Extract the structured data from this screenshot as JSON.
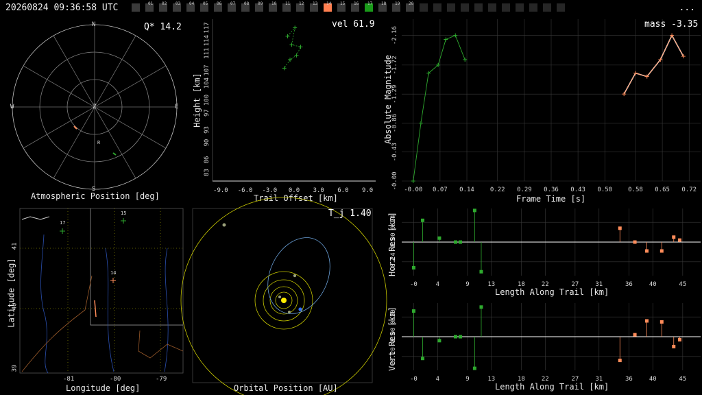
{
  "header": {
    "timestamp": "20260824 09:36:58 UTC",
    "menu_label": "...",
    "frames": [
      {
        "label": "",
        "state": "off"
      },
      {
        "label": "01",
        "state": "off"
      },
      {
        "label": "02",
        "state": "off"
      },
      {
        "label": "03",
        "state": "off"
      },
      {
        "label": "04",
        "state": "off"
      },
      {
        "label": "05",
        "state": "off"
      },
      {
        "label": "06",
        "state": "off"
      },
      {
        "label": "07",
        "state": "off"
      },
      {
        "label": "08",
        "state": "off"
      },
      {
        "label": "09",
        "state": "off"
      },
      {
        "label": "10",
        "state": "off"
      },
      {
        "label": "11",
        "state": "off"
      },
      {
        "label": "12",
        "state": "off"
      },
      {
        "label": "13",
        "state": "off"
      },
      {
        "label": "14",
        "state": "selected"
      },
      {
        "label": "15",
        "state": "off"
      },
      {
        "label": "16",
        "state": "off"
      },
      {
        "label": "17",
        "state": "active"
      },
      {
        "label": "18",
        "state": "off"
      },
      {
        "label": "19",
        "state": "off"
      },
      {
        "label": "20",
        "state": "off"
      },
      {
        "label": "",
        "state": "empty"
      },
      {
        "label": "",
        "state": "empty"
      },
      {
        "label": "",
        "state": "empty"
      },
      {
        "label": "",
        "state": "empty"
      },
      {
        "label": "",
        "state": "empty"
      },
      {
        "label": "",
        "state": "empty"
      },
      {
        "label": "",
        "state": "empty"
      },
      {
        "label": "",
        "state": "empty"
      },
      {
        "label": "",
        "state": "empty"
      },
      {
        "label": "",
        "state": "empty"
      },
      {
        "label": "",
        "state": "empty"
      }
    ]
  },
  "colors": {
    "selected": "#ff7f50",
    "active": "#1a9a1a",
    "inactive": "#3a3a3a",
    "trace": "#2eaa2e",
    "fit": "#ff8c5a",
    "grid": "#3a3a3a"
  },
  "sky": {
    "title": "Atmospheric Position [deg]",
    "q_label": "Q* 14.2",
    "cardinals": {
      "n": "N",
      "s": "S",
      "e": "E",
      "w": "W",
      "z": "Z"
    },
    "station_mark": "R"
  },
  "height_panel": {
    "readout": "vel 61.9",
    "xlabel": "Trail Offset [km]",
    "ylabel": "Height [km]",
    "xticks": [
      "-9.0",
      "-6.0",
      "-3.0",
      "0.0",
      "3.0",
      "6.0",
      "9.0"
    ],
    "yticks": [
      "117",
      "114",
      "111",
      "107",
      "104",
      "100",
      "97",
      "93",
      "90",
      "86",
      "83"
    ]
  },
  "mag_panel": {
    "readout": "mass -3.35",
    "xlabel": "Frame Time [s]",
    "ylabel": "Absolute Magnitude",
    "xticks": [
      "-0.00",
      "0.07",
      "0.14",
      "0.22",
      "0.29",
      "0.36",
      "0.43",
      "0.50",
      "0.58",
      "0.65",
      "0.72"
    ],
    "yticks": [
      "-2.16",
      "-1.72",
      "-1.29",
      "-0.86",
      "-0.43",
      "-0.00"
    ]
  },
  "map_panel": {
    "xlabel": "Longitude [deg]",
    "ylabel": "Latitude [deg]",
    "xticks": [
      "-81",
      "-80",
      "-79"
    ],
    "yticks": [
      "41",
      "40",
      "39"
    ],
    "markers": [
      "17",
      "15",
      "14"
    ]
  },
  "orbit_panel": {
    "readout": "T_j 1.40",
    "xlabel": "Orbital Position [AU]"
  },
  "horz_panel": {
    "xlabel": "Length Along Trail [km]",
    "ylabel": "Horz Res [km]",
    "xticks": [
      "-0",
      "4",
      "9",
      "13",
      "18",
      "22",
      "27",
      "31",
      "36",
      "40",
      "45"
    ],
    "yticks": [
      "0.24",
      "-0.00",
      "-0.24"
    ]
  },
  "vert_panel": {
    "xlabel": "Length Along Trail [km]",
    "ylabel": "Vert Res [km]",
    "xticks": [
      "-0",
      "4",
      "9",
      "13",
      "18",
      "22",
      "27",
      "31",
      "36",
      "40",
      "45"
    ],
    "yticks": [
      "0.20",
      "-0.00",
      "-0.20"
    ]
  },
  "chart_data": [
    {
      "type": "scatter",
      "name": "height-vs-offset",
      "xlabel": "Trail Offset [km]",
      "ylabel": "Height [km]",
      "xlim": [
        -10,
        10
      ],
      "ylim": [
        81,
        119
      ],
      "series": [
        {
          "x": [
            -0.8,
            0.1,
            -0.3,
            0.8,
            0.3,
            -0.5,
            -1.2
          ],
          "y": [
            115,
            117,
            113,
            112.5,
            110.5,
            109.5,
            107.5
          ]
        }
      ]
    },
    {
      "type": "line",
      "name": "magnitude-vs-time",
      "xlabel": "Frame Time [s]",
      "ylabel": "Absolute Magnitude",
      "xlim": [
        -0.03,
        0.75
      ],
      "ylim": [
        0.0,
        -2.4
      ],
      "series": [
        {
          "x": [
            0.0,
            0.02,
            0.04,
            0.065,
            0.085,
            0.11,
            0.135
          ],
          "y": [
            0.0,
            -0.86,
            -1.6,
            -1.72,
            -2.1,
            -2.16,
            -1.8
          ],
          "color": "#2eaa2e"
        },
        {
          "x": [
            0.55,
            0.58,
            0.61,
            0.645,
            0.675,
            0.705
          ],
          "y": [
            -1.29,
            -1.6,
            -1.55,
            -1.8,
            -2.16,
            -1.85
          ],
          "color": "#ff8c5a"
        }
      ]
    },
    {
      "type": "scatter",
      "name": "horizontal-residuals",
      "xlabel": "Length Along Trail [km]",
      "ylabel": "Horz Res [km]",
      "xlim": [
        -2,
        48
      ],
      "ylim": [
        -0.34,
        0.34
      ],
      "series": [
        {
          "x": [
            0,
            1.5,
            4.3,
            7,
            7.8,
            10.2,
            11.3
          ],
          "y": [
            -0.26,
            0.22,
            0.04,
            0.0,
            0.0,
            0.32,
            -0.3
          ],
          "color": "#2eaa2e"
        },
        {
          "x": [
            34.5,
            37,
            39,
            41.5,
            43.5,
            44.5
          ],
          "y": [
            0.14,
            0.0,
            -0.09,
            -0.09,
            0.05,
            0.02
          ],
          "color": "#ff8c5a"
        }
      ]
    },
    {
      "type": "scatter",
      "name": "vertical-residuals",
      "xlabel": "Length Along Trail [km]",
      "ylabel": "Vert Res [km]",
      "xlim": [
        -2,
        48
      ],
      "ylim": [
        -0.34,
        0.34
      ],
      "series": [
        {
          "x": [
            0,
            1.5,
            4.3,
            7,
            7.8,
            10.2,
            11.3
          ],
          "y": [
            0.26,
            -0.22,
            -0.04,
            0.0,
            0.0,
            -0.32,
            0.3
          ],
          "color": "#2eaa2e"
        },
        {
          "x": [
            34.5,
            37,
            39,
            41.5,
            43.5,
            44.5
          ],
          "y": [
            -0.24,
            0.02,
            0.16,
            0.15,
            -0.1,
            -0.03
          ],
          "color": "#ff8c5a"
        }
      ]
    }
  ]
}
